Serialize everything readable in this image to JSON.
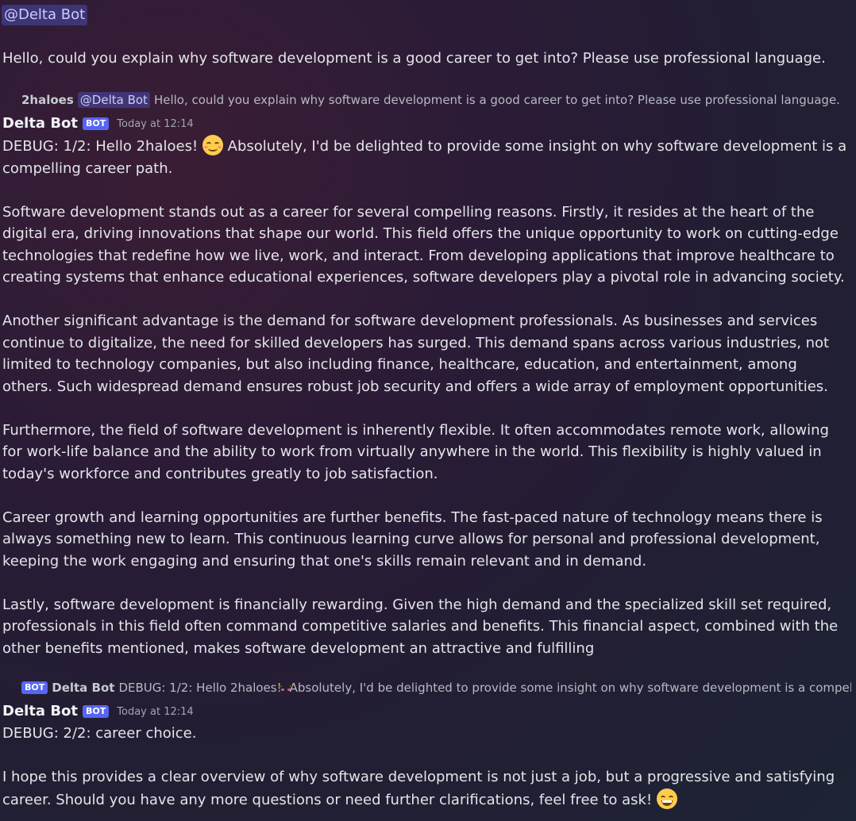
{
  "user_message": {
    "mention": "@Delta Bot",
    "text": "Hello, could you explain why software development is a good career to get into? Please use professional language."
  },
  "reply_1": {
    "author": "2haloes",
    "mention": "@Delta Bot",
    "text": "Hello, could you explain why software development is a good career to get into? Please use professional language."
  },
  "message_1": {
    "username": "Delta Bot",
    "bot_tag": "BOT",
    "timestamp": "Today at 12:14",
    "intro_before_emoji": "DEBUG: 1/2: Hello 2haloes!",
    "intro_emoji": "smiling-face-with-smiling-eyes",
    "intro_after_emoji": "Absolutely, I'd be delighted to provide some insight on why software development is a compelling career path.",
    "paragraphs": [
      "Software development stands out as a career for several compelling reasons. Firstly, it resides at the heart of the digital era, driving innovations that shape our world. This field offers the unique opportunity to work on cutting-edge technologies that redefine how we live, work, and interact. From developing applications that improve healthcare to creating systems that enhance educational experiences, software developers play a pivotal role in advancing society.",
      "Another significant advantage is the demand for software development professionals. As businesses and services continue to digitalize, the need for skilled developers has surged. This demand spans across various industries, not limited to technology companies, but also including finance, healthcare, education, and entertainment, among others. Such widespread demand ensures robust job security and offers a wide array of employment opportunities.",
      "Furthermore, the field of software development is inherently flexible. It often accommodates remote work, allowing for work-life balance and the ability to work from virtually anywhere in the world. This flexibility is highly valued in today's workforce and contributes greatly to job satisfaction.",
      "Career growth and learning opportunities are further benefits. The fast-paced nature of technology means there is always something new to learn. This continuous learning curve allows for personal and professional development, keeping the work engaging and ensuring that one's skills remain relevant and in demand.",
      "Lastly, software development is financially rewarding. Given the high demand and the specialized skill set required, professionals in this field often command competitive salaries and benefits. This financial aspect, combined with the other benefits mentioned, makes software development an attractive and fulfilling"
    ]
  },
  "reply_2": {
    "bot_tag": "BOT",
    "author": "Delta Bot",
    "text_before_emoji": "DEBUG: 1/2: Hello 2haloes!",
    "text_after_emoji": "Absolutely, I'd be delighted to provide some insight on why software development is a compelli"
  },
  "message_2": {
    "username": "Delta Bot",
    "bot_tag": "BOT",
    "timestamp": "Today at 12:14",
    "paragraphs": [
      "DEBUG: 2/2: career choice.",
      "I hope this provides a clear overview of why software development is not just a job, but a progressive and satisfying career. Should you have any more questions or need further clarifications, feel free to ask!"
    ],
    "closing_emoji": "grinning-face-with-smiling-eyes"
  }
}
